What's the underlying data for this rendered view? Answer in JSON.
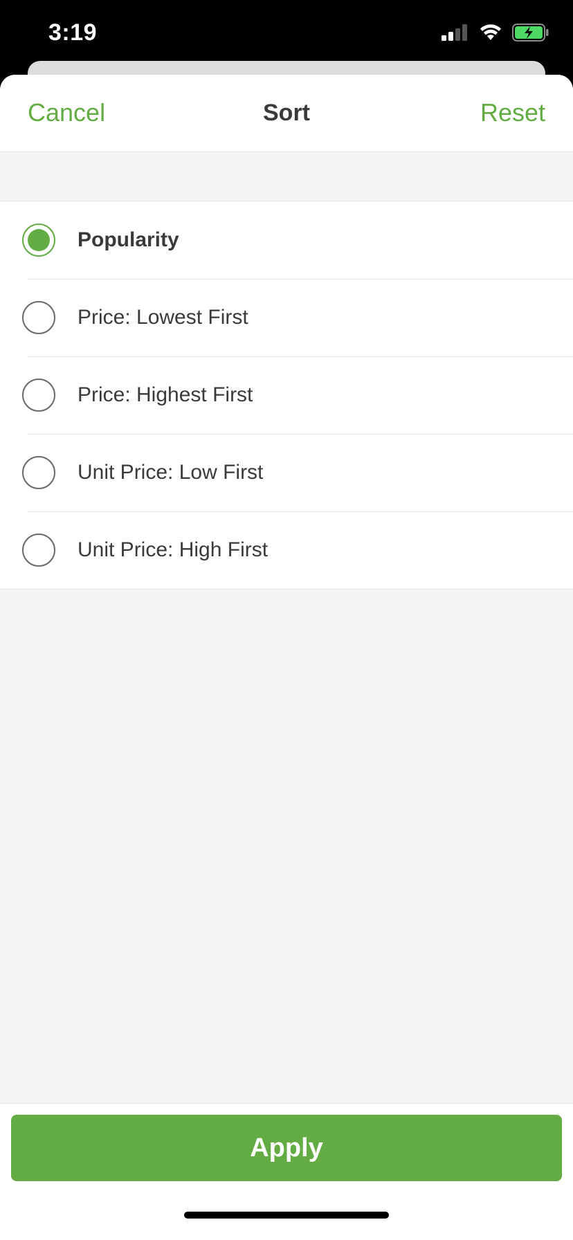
{
  "status_bar": {
    "time": "3:19",
    "icons": [
      "cellular-signal-icon",
      "wifi-icon",
      "battery-charging-icon"
    ]
  },
  "nav": {
    "cancel_label": "Cancel",
    "title": "Sort",
    "reset_label": "Reset"
  },
  "sort_options": [
    {
      "label": "Popularity",
      "selected": true
    },
    {
      "label": "Price: Lowest First",
      "selected": false
    },
    {
      "label": "Price: Highest First",
      "selected": false
    },
    {
      "label": "Unit Price: Low First",
      "selected": false
    },
    {
      "label": "Unit Price: High First",
      "selected": false
    }
  ],
  "footer": {
    "apply_label": "Apply"
  },
  "colors": {
    "accent": "#62ac43",
    "text": "#3a3a3a",
    "background": "#f5f5f5"
  }
}
